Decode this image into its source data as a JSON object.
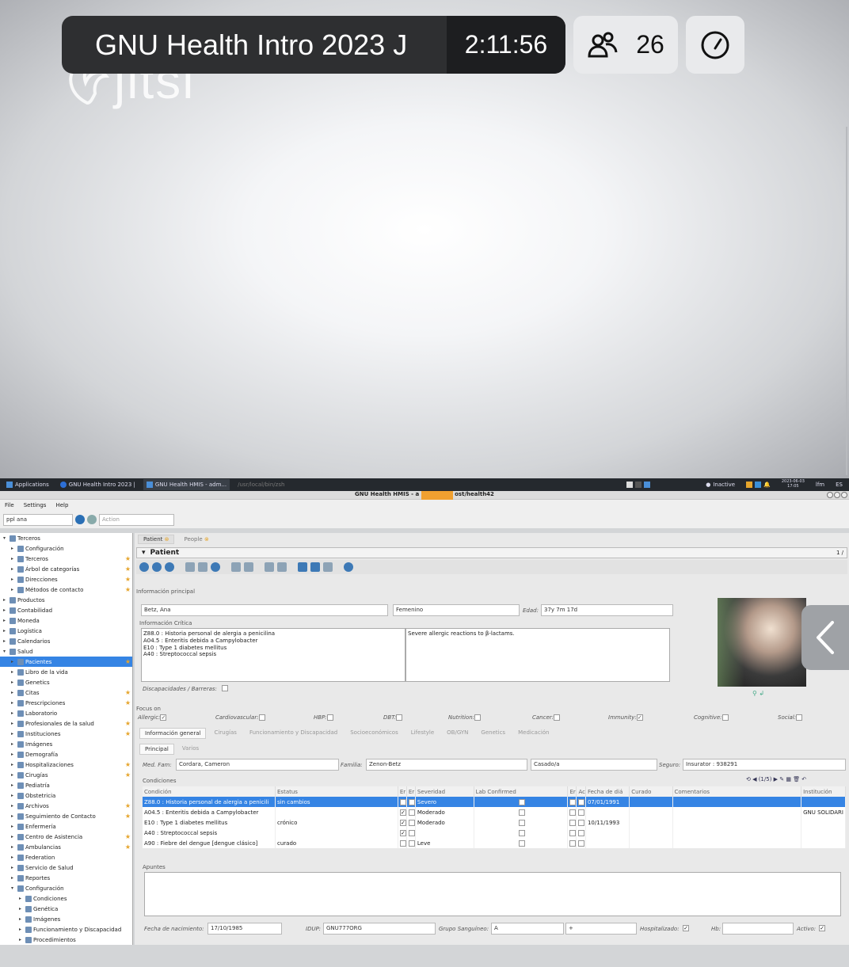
{
  "meeting": {
    "title": "GNU Health Intro 2023 J",
    "timer": "2:11:56",
    "participants": "26",
    "logo_text": "jitsi"
  },
  "taskbar": {
    "items": [
      "Applications",
      "GNU Health Intro 2023 |",
      "GNU Health HMIS - adm...",
      "/usr/local/bin/zsh"
    ],
    "status": "Inactive",
    "date": "2023-06-03",
    "time": "17:05",
    "user": "lfm",
    "lang": "ES"
  },
  "window": {
    "title": "GNU Health HMIS - a",
    "title_suffix": "ost/health42"
  },
  "menu": [
    "File",
    "Settings",
    "Help"
  ],
  "search": {
    "value": "ppl ana",
    "action_placeholder": "Action"
  },
  "sidebar": [
    {
      "label": "Terceros",
      "level": 0,
      "open": true
    },
    {
      "label": "Configuración",
      "level": 1
    },
    {
      "label": "Terceros",
      "level": 1,
      "star": true
    },
    {
      "label": "Árbol de categorías",
      "level": 1,
      "star": true
    },
    {
      "label": "Direcciones",
      "level": 1,
      "star": true
    },
    {
      "label": "Métodos de contacto",
      "level": 1,
      "star": true
    },
    {
      "label": "Productos",
      "level": 0
    },
    {
      "label": "Contabilidad",
      "level": 0
    },
    {
      "label": "Moneda",
      "level": 0
    },
    {
      "label": "Logística",
      "level": 0
    },
    {
      "label": "Calendarios",
      "level": 0
    },
    {
      "label": "Salud",
      "level": 0,
      "open": true
    },
    {
      "label": "Pacientes",
      "level": 1,
      "star": true,
      "selected": true
    },
    {
      "label": "Libro de la vida",
      "level": 1
    },
    {
      "label": "Genetics",
      "level": 1
    },
    {
      "label": "Citas",
      "level": 1,
      "star": true
    },
    {
      "label": "Prescripciones",
      "level": 1,
      "star": true
    },
    {
      "label": "Laboratorio",
      "level": 1
    },
    {
      "label": "Profesionales de la salud",
      "level": 1,
      "star": true
    },
    {
      "label": "Instituciones",
      "level": 1,
      "star": true
    },
    {
      "label": "Imágenes",
      "level": 1
    },
    {
      "label": "Demografía",
      "level": 1
    },
    {
      "label": "Hospitalizaciones",
      "level": 1,
      "star": true
    },
    {
      "label": "Cirugías",
      "level": 1,
      "star": true
    },
    {
      "label": "Pediatría",
      "level": 1
    },
    {
      "label": "Obstetricia",
      "level": 1
    },
    {
      "label": "Archivos",
      "level": 1,
      "star": true
    },
    {
      "label": "Seguimiento de Contacto",
      "level": 1,
      "star": true
    },
    {
      "label": "Enfermería",
      "level": 1
    },
    {
      "label": "Centro de Asistencia",
      "level": 1,
      "star": true
    },
    {
      "label": "Ambulancias",
      "level": 1,
      "star": true
    },
    {
      "label": "Federation",
      "level": 1
    },
    {
      "label": "Servicio de Salud",
      "level": 1
    },
    {
      "label": "Reportes",
      "level": 1
    },
    {
      "label": "Configuración",
      "level": 1,
      "open": true
    },
    {
      "label": "Condiciones",
      "level": 2
    },
    {
      "label": "Genética",
      "level": 2
    },
    {
      "label": "Imágenes",
      "level": 2
    },
    {
      "label": "Funcionamiento y Discapacidad",
      "level": 2
    },
    {
      "label": "Procedimientos",
      "level": 2
    }
  ],
  "tabs": [
    {
      "label": "Patient"
    },
    {
      "label": "People"
    }
  ],
  "form": {
    "title": "Patient",
    "page": "1 /",
    "info_principal": "Información principal",
    "name": "Betz, Ana",
    "gender": "Femenino",
    "age_label": "Edad:",
    "age": "37y 7m 17d",
    "critical_label": "Información Crítica",
    "critical_list": [
      "Z88.0 : Historia personal de alergia a penicilina",
      "A04.5 : Enteritis debida a Campylobacter",
      "E10 : Type 1 diabetes mellitus",
      "A40 : Streptococcal sepsis"
    ],
    "critical_note": "Severe allergic reactions to β-lactams.",
    "disability_label": "Discapacidades / Barreras:",
    "focus_label": "Focus on",
    "focus": [
      {
        "label": "Allergic:",
        "checked": true
      },
      {
        "label": "Cardiovascular:",
        "checked": false
      },
      {
        "label": "HBP:",
        "checked": false
      },
      {
        "label": "DBT:",
        "checked": false
      },
      {
        "label": "Nutrition:",
        "checked": false
      },
      {
        "label": "Cancer:",
        "checked": false
      },
      {
        "label": "Immunity:",
        "checked": true
      },
      {
        "label": "Cognitive:",
        "checked": false
      },
      {
        "label": "Social:",
        "checked": false
      }
    ],
    "subtabs": [
      "Información general",
      "Cirugías",
      "Funcionamiento y Discapacidad",
      "Socioeconómicos",
      "Lifestyle",
      "OB/GYN",
      "Genetics",
      "Medicación"
    ],
    "subtabs2": [
      "Principal",
      "Varios"
    ],
    "med_fam_label": "Med. Fam:",
    "med_fam": "Cordara, Cameron",
    "familia_label": "Familia:",
    "familia": "Zenon-Betz",
    "marital": "Casado/a",
    "seguro_label": "Seguro:",
    "seguro": "Insurator : 938291",
    "conditions_label": "Condiciones",
    "conditions_pager": "(1/5)",
    "columns": [
      "Condición",
      "Estatus",
      "Er",
      "Er",
      "Severidad",
      "Lab Confirmed",
      "Er",
      "Ac",
      "Fecha de diá",
      "Curado",
      "Comentarios",
      "Institución"
    ],
    "rows": [
      {
        "cond": "Z88.0 : Historia personal de alergia a penicili",
        "status": "sin cambios",
        "sev": "Severo",
        "date": "07/01/1991",
        "inst": "",
        "selected": true
      },
      {
        "cond": "A04.5 : Enteritis debida a Campylobacter",
        "status": "",
        "sev": "Moderado",
        "date": "",
        "inst": "GNU SOLIDARI"
      },
      {
        "cond": "E10 : Type 1 diabetes mellitus",
        "status": "crónico",
        "sev": "Moderado",
        "date": "10/11/1993",
        "inst": ""
      },
      {
        "cond": "A40 : Streptococcal sepsis",
        "status": "",
        "sev": "",
        "date": "",
        "inst": ""
      },
      {
        "cond": "A90 : Fiebre del dengue [dengue clásico]",
        "status": "curado",
        "sev": "Leve",
        "date": "",
        "inst": ""
      }
    ],
    "notes_label": "Apuntes",
    "dob_label": "Fecha de nacimiento:",
    "dob": "17/10/1985",
    "idup_label": "IDUP:",
    "idup": "GNU777ORG",
    "blood_label": "Grupo Sanguíneo:",
    "blood": "A",
    "rh": "+",
    "hosp_label": "Hospitalizado:",
    "hb_label": "Hb:",
    "active_label": "Activo:"
  },
  "colors": {
    "accent": "#3584e4",
    "star": "#e6a52c",
    "meeting_bar": "#2e2f31"
  }
}
